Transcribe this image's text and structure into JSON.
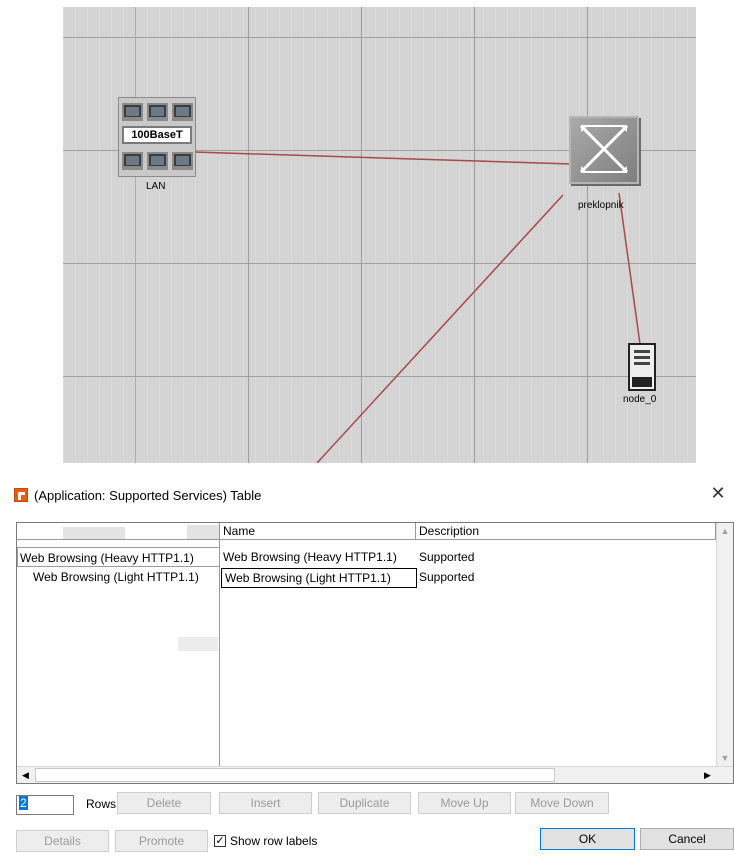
{
  "canvas": {
    "lan_band_label": "100BaseT",
    "lan_label": "LAN",
    "switch_label": "preklopnik",
    "server_label": "node_0",
    "link_color": "#a84a4a"
  },
  "dialog": {
    "title": "(Application: Supported Services) Table",
    "close_glyph": "✕",
    "columns": [
      "Name",
      "Description"
    ],
    "rows": [
      {
        "label": "Web Browsing (Heavy HTTP1.1)",
        "name": "Web Browsing (Heavy HTTP1.1)",
        "description": "Supported"
      },
      {
        "label": "Web Browsing (Light HTTP1.1)",
        "name": "Web Browsing (Light HTTP1.1)",
        "description": "Supported"
      }
    ],
    "rows_count": "2",
    "rows_label": "Rows",
    "buttons": {
      "delete": "Delete",
      "insert": "Insert",
      "duplicate": "Duplicate",
      "move_up": "Move Up",
      "move_down": "Move Down",
      "details": "Details",
      "promote": "Promote",
      "ok": "OK",
      "cancel": "Cancel"
    },
    "show_row_labels": {
      "label": "Show row labels",
      "checked": true
    },
    "accent_color": "#e85d10"
  }
}
